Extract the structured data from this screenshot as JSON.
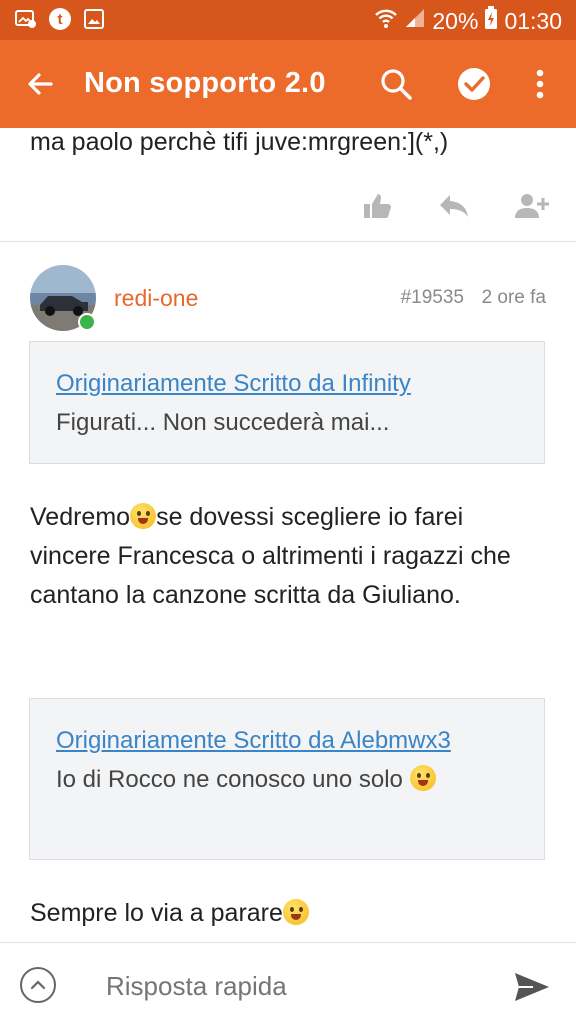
{
  "status_bar": {
    "battery": "20%",
    "time": "01:30"
  },
  "app_bar": {
    "title": "Non sopporto 2.0"
  },
  "previous_post": {
    "text": "ma paolo perchè tifi juve:mrgreen:](*,)"
  },
  "post": {
    "username": "redi-one",
    "post_number": "#19535",
    "time": "2 ore fa",
    "quote1": {
      "link": "Originariamente Scritto da Infinity",
      "text": "Figurati... Non succederà mai..."
    },
    "body1_a": "Vedremo",
    "body1_b": "se dovessi scegliere io farei vincere Francesca o altrimenti i ragazzi che cantano la canzone scritta da Giuliano.",
    "quote2": {
      "link": "Originariamente Scritto da Alebmwx3",
      "text": "Io di Rocco ne conosco uno solo"
    },
    "body2": "Sempre lo via a parare"
  },
  "bottom_bar": {
    "placeholder": "Risposta rapida"
  }
}
